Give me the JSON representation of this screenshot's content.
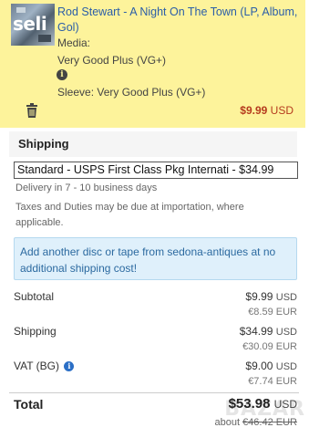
{
  "item": {
    "thumbnail_text": "seli",
    "title": "Rod Stewart - A Night On The Town (LP, Album, Gol)",
    "media_label": "Media:",
    "media_value": "Very Good Plus (VG+)",
    "info_glyph": "i",
    "sleeve": "Sleeve: Very Good Plus (VG+)",
    "price": "$9.99",
    "price_currency": "USD",
    "card_color": "#fdf39b",
    "price_color": "#b53b1e"
  },
  "shipping": {
    "title": "Shipping",
    "selected_option": "Standard - USPS First Class Pkg Internati - $34.99",
    "delivery": "Delivery in 7 - 10 business days",
    "taxes_note": "Taxes and Duties may be due at importation, where applicable.",
    "promo": "Add another disc or tape from sedona-antiques at no additional shipping cost!"
  },
  "totals": {
    "subtotal_label": "Subtotal",
    "subtotal_usd": "$9.99",
    "subtotal_eur": "€8.59 EUR",
    "shipping_label": "Shipping",
    "shipping_usd": "$34.99",
    "shipping_eur": "€30.09 EUR",
    "vat_label": "VAT (BG)",
    "vat_usd": "$9.00",
    "vat_eur": "€7.74 EUR",
    "currency": "USD",
    "total_label": "Total",
    "total_usd": "$53.98",
    "total_eur_prefix": "about",
    "total_eur": "€46.42 EUR"
  },
  "icons": {
    "delete": "trash-icon",
    "info": "info-icon"
  },
  "watermark": "BAZAR"
}
